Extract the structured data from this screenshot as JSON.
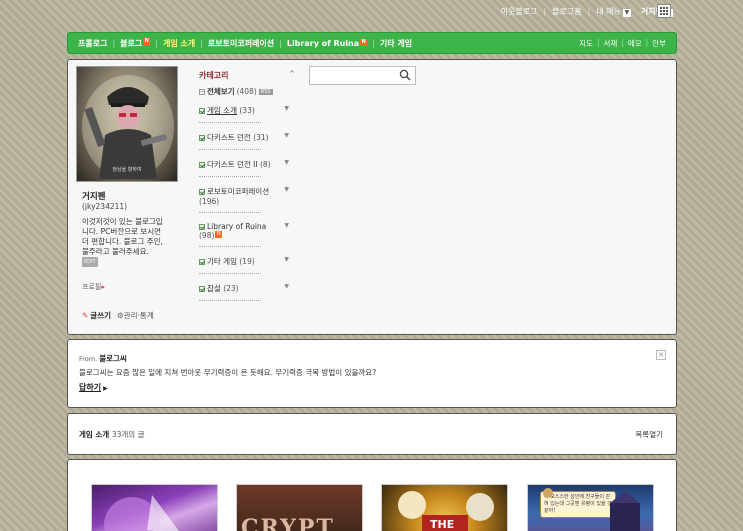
{
  "topbar": {
    "links": [
      "이웃블로그",
      "블로그홈",
      "내 메뉴"
    ],
    "user": "거지펜"
  },
  "nav": {
    "items": [
      {
        "label": "프롤로그",
        "badge": false,
        "active": false
      },
      {
        "label": "블로그",
        "badge": true,
        "active": false
      },
      {
        "label": "게임 소개",
        "badge": false,
        "active": true
      },
      {
        "label": "로보토미코퍼레이션",
        "badge": false,
        "active": false
      },
      {
        "label": "Library of Ruina",
        "badge": true,
        "active": false
      },
      {
        "label": "기타 게임",
        "badge": false,
        "active": false
      }
    ],
    "badge_text": "N",
    "right": [
      "지도",
      "서재",
      "메모",
      "안부"
    ]
  },
  "profile": {
    "image_caption": "정상을 향하여",
    "name": "거지펜",
    "id": "(jky234211)",
    "description": "이것저것이 있는 블로그입니다. PC버전으로 보시면 더 편합니다. 블로그 주인, 불주라고 불러주세요.",
    "edit_tag": "EDIT",
    "profile_link": "프로필",
    "write_label": "글쓰기",
    "admin_label": "관리·통계"
  },
  "categories": {
    "header": "카테고리",
    "all": {
      "label": "전체보기",
      "count": "(408)",
      "tag": "RSS"
    },
    "items": [
      {
        "label": "게임 소개",
        "count": "(33)",
        "current": true,
        "badge": false
      },
      {
        "label": "다키스트 던전",
        "count": "(31)",
        "current": false,
        "badge": false
      },
      {
        "label": "다키스트 던전 II",
        "count": "(8)",
        "current": false,
        "badge": false
      },
      {
        "label": "로보토미코퍼레이션",
        "count": "(196)",
        "current": false,
        "badge": false
      },
      {
        "label": "Library of Ruina",
        "count": "(98)",
        "current": false,
        "badge": true
      },
      {
        "label": "기타 게임",
        "count": "(19)",
        "current": false,
        "badge": false
      },
      {
        "label": "잡설",
        "count": "(23)",
        "current": false,
        "badge": false
      }
    ]
  },
  "search": {
    "placeholder": ""
  },
  "message": {
    "from_prefix": "From.",
    "from_name": "블로그씨",
    "text": "블로그씨는 요즘 많은 일에 지쳐 번아웃 무기력증이 온 듯해요. 무기력증 극복 방법이 있을까요?",
    "answer": "답하기",
    "close": "×"
  },
  "list": {
    "category": "게임 소개",
    "count_num": "33",
    "count_suffix": "개의 글",
    "toggle": "목록열기"
  },
  "thumbnails": {
    "crypt_text": "CRYPT",
    "thumb3_text": "THE",
    "thumb4_bubble": "이 모스스한 성안에 친구들이 갇혀 있는데 그곳엔 유령이 있을 것 같아!"
  },
  "colors": {
    "nav_green": "#3cb449",
    "nav_active": "#fffa7a",
    "category_header": "#8a2a2a",
    "badge_orange": "#f46a25"
  }
}
